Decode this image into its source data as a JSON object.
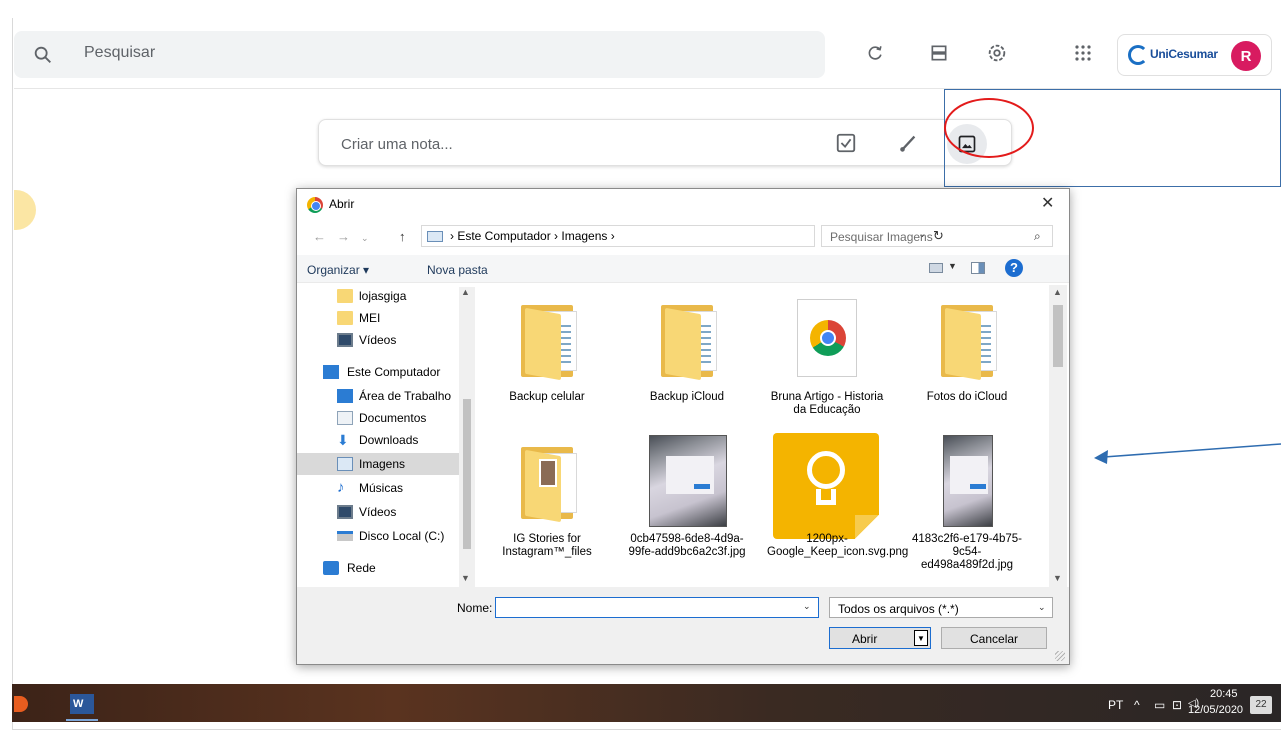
{
  "header": {
    "search_placeholder": "Pesquisar",
    "icons": [
      "refresh-icon",
      "list-view-icon",
      "settings-icon",
      "apps-grid-icon"
    ],
    "brand_name": "UniCesumar",
    "avatar_initial": "R"
  },
  "note": {
    "placeholder": "Criar uma nota...",
    "icons": [
      "checkbox-icon",
      "brush-icon",
      "image-icon"
    ]
  },
  "dialog": {
    "title": "Abrir",
    "close": "✕",
    "address": "›  Este Computador  ›  Imagens  ›",
    "search_placeholder": "Pesquisar Imagens",
    "toolbar": {
      "organize": "Organizar ▾",
      "new_folder": "Nova pasta"
    },
    "nav_items": [
      {
        "label": "lojasgiga",
        "icon": "folder"
      },
      {
        "label": "MEI",
        "icon": "folder"
      },
      {
        "label": "Vídeos",
        "icon": "video"
      },
      {
        "label": "Este Computador",
        "icon": "pc"
      },
      {
        "label": "Área de Trabalho",
        "icon": "desktop"
      },
      {
        "label": "Documentos",
        "icon": "doc"
      },
      {
        "label": "Downloads",
        "icon": "down"
      },
      {
        "label": "Imagens",
        "icon": "img",
        "selected": true
      },
      {
        "label": "Músicas",
        "icon": "music"
      },
      {
        "label": "Vídeos",
        "icon": "video"
      },
      {
        "label": "Disco Local (C:)",
        "icon": "disk"
      },
      {
        "label": "Rede",
        "icon": "net"
      }
    ],
    "files": [
      {
        "label": "Backup celular"
      },
      {
        "label": "Backup iCloud"
      },
      {
        "label": "Bruna Artigo - Historia da Educação"
      },
      {
        "label": "Fotos do iCloud"
      },
      {
        "label": "IG Stories for Instagram™_files"
      },
      {
        "label": "0cb47598-6de8-4d9a-99fe-add9bc6a2c3f.jpg"
      },
      {
        "label": "1200px-Google_Keep_icon.svg.png"
      },
      {
        "label": "4183c2f6-e179-4b75-9c54-ed498a489f2d.jpg"
      }
    ],
    "name_label": "Nome:",
    "name_value": "",
    "file_type": "Todos os arquivos (*.*)",
    "open_label": "Abrir",
    "cancel_label": "Cancelar"
  },
  "taskbar": {
    "word_letter": "W",
    "language": "PT",
    "time": "20:45",
    "date": "12/05/2020",
    "notifications": "22"
  }
}
